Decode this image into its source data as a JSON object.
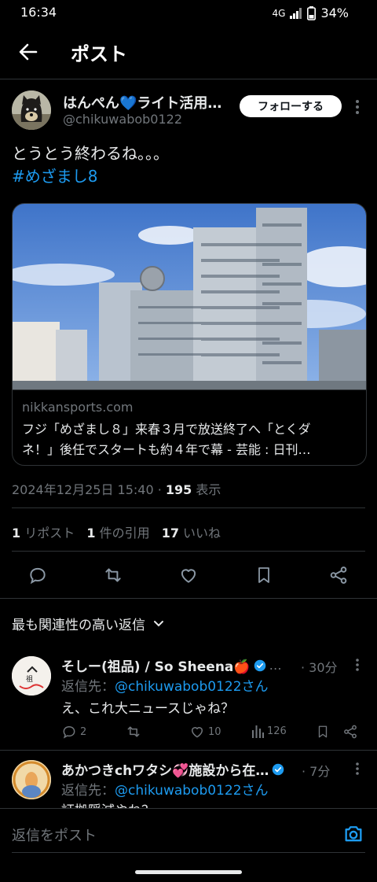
{
  "status": {
    "time": "16:34",
    "network": "4G",
    "battery": "34%"
  },
  "header": {
    "title": "ポスト"
  },
  "post": {
    "display_name": "はんぺん💙ライト活用…",
    "handle": "@chikuwabob0122",
    "follow_label": "フォローする",
    "text_line1": "とうとう終わるね。。。",
    "hashtag": "#めざまし8",
    "link_domain": "nikkansports.com",
    "link_title_1": "フジ「めざまし８」来春３月で放送終了へ「とくダ",
    "link_title_2": "ネ！」後任でスタートも約４年で幕 - 芸能 : 日刊…",
    "timestamp": "2024年12月25日 15:40",
    "views_count": "195",
    "views_label": "表示",
    "reposts_count": "1",
    "reposts_label": "リポスト",
    "quotes_count": "1",
    "quotes_label": "件の引用",
    "likes_count": "17",
    "likes_label": "いいね"
  },
  "replies_section": {
    "sort_label": "最も関連性の高い返信"
  },
  "replies": [
    {
      "name": "そしー(祖品) / So Sheena🍎",
      "time": "· 30分",
      "reply_to_prefix": "返信先：",
      "reply_to_handle": "@chikuwabob0122さん",
      "text": "え、これ大ニュースじゃね？",
      "reply_count": "2",
      "like_count": "10",
      "view_count": "126"
    },
    {
      "name": "あかつきchワタシ💞施設から在…",
      "time": "· 7分",
      "reply_to_prefix": "返信先：",
      "reply_to_handle": "@chikuwabob0122さん",
      "text": "証拠隠滅やね？"
    }
  ],
  "composer": {
    "placeholder": "返信をポスト"
  },
  "colors": {
    "accent": "#1d9bf0",
    "background": "#000000",
    "muted": "#71767b"
  }
}
